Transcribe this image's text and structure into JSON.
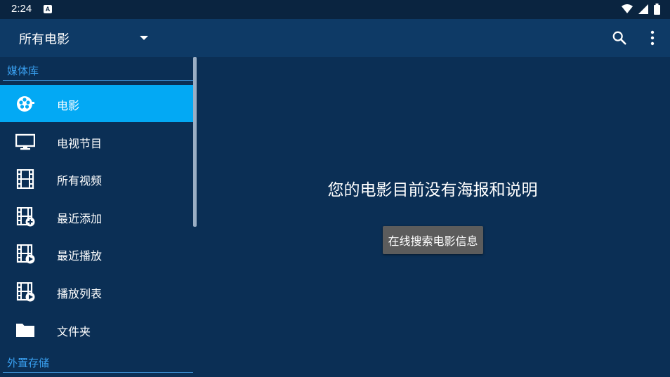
{
  "status_bar": {
    "time": "2:24",
    "notification_letter": "A",
    "icons": [
      "wifi-icon",
      "signal-icon",
      "battery-icon"
    ]
  },
  "app_bar": {
    "title": "所有电影",
    "actions": [
      "search-icon",
      "more-vert-icon"
    ]
  },
  "drawer": {
    "sections": [
      {
        "header": "媒体库",
        "items": [
          {
            "label": "电影",
            "icon": "movie-reel-icon",
            "active": true
          },
          {
            "label": "电视节目",
            "icon": "tv-monitor-icon",
            "active": false
          },
          {
            "label": "所有视频",
            "icon": "film-strip-icon",
            "active": false
          },
          {
            "label": "最近添加",
            "icon": "film-add-icon",
            "active": false
          },
          {
            "label": "最近播放",
            "icon": "film-play-icon",
            "active": false
          },
          {
            "label": "播放列表",
            "icon": "film-playlist-icon",
            "active": false
          },
          {
            "label": "文件夹",
            "icon": "folder-icon",
            "active": false
          }
        ]
      },
      {
        "header": "外置存储",
        "items": []
      }
    ]
  },
  "main": {
    "empty_message": "您的电影目前没有海报和说明",
    "search_online_button": "在线搜索电影信息"
  },
  "colors": {
    "status_bar": "#0a2440",
    "app_bar": "#0e3a66",
    "background": "#0b2f55",
    "active_item": "#03a9f4",
    "section_header": "#39a0f0",
    "button": "#5c5c5c"
  }
}
